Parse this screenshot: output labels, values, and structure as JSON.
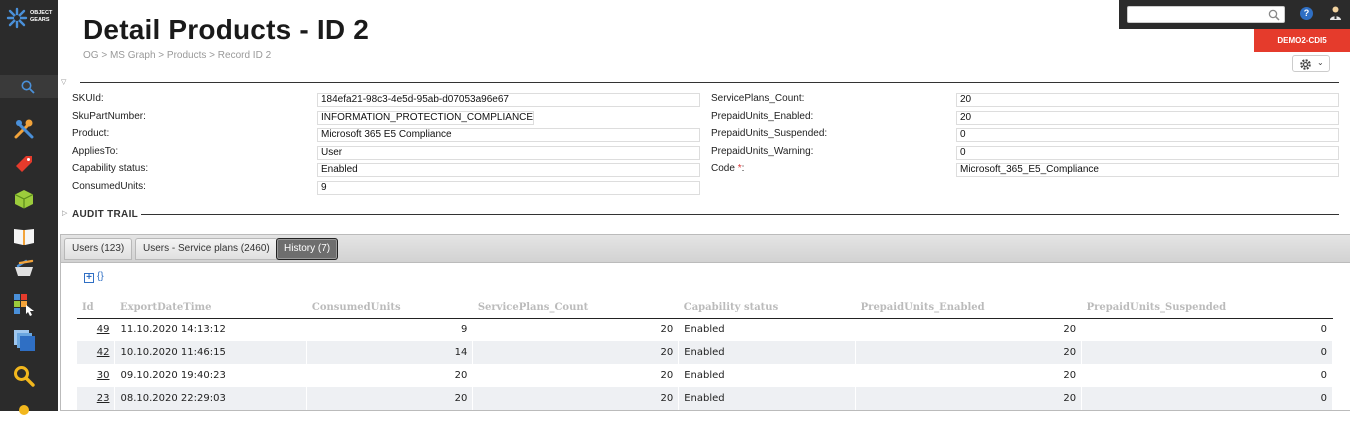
{
  "header": {
    "title": "Detail Products - ID 2",
    "breadcrumb": "OG > MS Graph > Products > Record ID 2"
  },
  "logo": {
    "line1": "OBJECT",
    "line2": "GEARS"
  },
  "topbar": {
    "search_placeholder": "",
    "help_label": "?",
    "environment": "DEMO2-CDI5"
  },
  "sidebar": {
    "icons": [
      "tools-icon",
      "tag-icon",
      "cubes-icon",
      "book-icon",
      "cart-icon",
      "apps-icon",
      "documents-icon",
      "search-icon",
      "sun-icon"
    ]
  },
  "form": {
    "left": [
      {
        "label": "SKUId:",
        "value": "184efa21-98c3-4e5d-95ab-d07053a96e67"
      },
      {
        "label": "SkuPartNumber:",
        "value": "INFORMATION_PROTECTION_COMPLIANCE"
      },
      {
        "label": "Product:",
        "value": "Microsoft 365 E5 Compliance"
      },
      {
        "label": "AppliesTo:",
        "value": "User"
      },
      {
        "label": "Capability status:",
        "value": "Enabled"
      },
      {
        "label": "ConsumedUnits:",
        "value": "9"
      }
    ],
    "right": [
      {
        "label": "ServicePlans_Count:",
        "value": "20"
      },
      {
        "label": "PrepaidUnits_Enabled:",
        "value": "20"
      },
      {
        "label": "PrepaidUnits_Suspended:",
        "value": "0"
      },
      {
        "label": "PrepaidUnits_Warning:",
        "value": "0"
      },
      {
        "label": "Code",
        "required": "*",
        "colon": ":",
        "value": "Microsoft_365_E5_Compliance"
      }
    ]
  },
  "audit_trail": {
    "label": "AUDIT TRAIL"
  },
  "tabs": [
    {
      "label": "Users (123)"
    },
    {
      "label": "Users - Service plans (2460)"
    },
    {
      "label": "History (7)",
      "active": true
    }
  ],
  "toolbar": {
    "add_label": "+",
    "json_label": "{}"
  },
  "table": {
    "columns": [
      "Id",
      "ExportDateTime",
      "ConsumedUnits",
      "ServicePlans_Count",
      "Capability status",
      "PrepaidUnits_Enabled",
      "PrepaidUnits_Suspended"
    ],
    "rows": [
      [
        "49",
        "11.10.2020 14:13:12",
        "9",
        "20",
        "Enabled",
        "20",
        "0"
      ],
      [
        "42",
        "10.10.2020 11:46:15",
        "14",
        "20",
        "Enabled",
        "20",
        "0"
      ],
      [
        "30",
        "09.10.2020 19:40:23",
        "20",
        "20",
        "Enabled",
        "20",
        "0"
      ],
      [
        "23",
        "08.10.2020 22:29:03",
        "20",
        "20",
        "Enabled",
        "20",
        "0"
      ]
    ]
  }
}
